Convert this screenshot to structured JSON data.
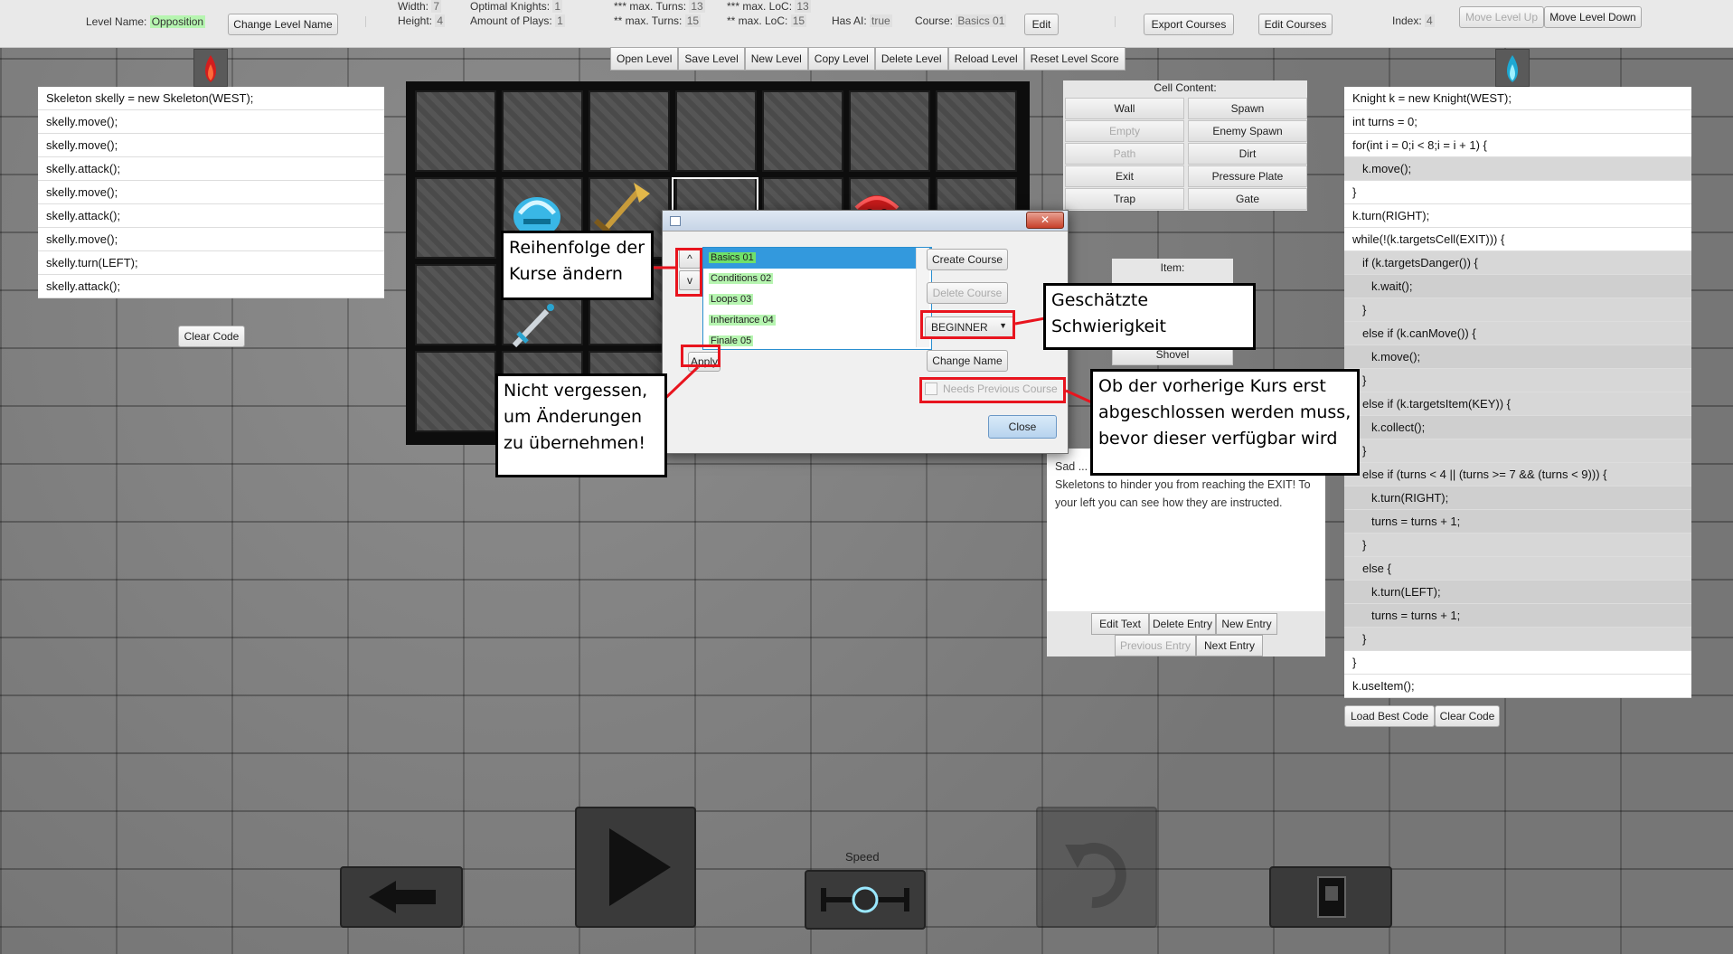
{
  "topbar": {
    "level_name_label": "Level Name:",
    "level_name_value": "Opposition",
    "change_level_name": "Change Level Name",
    "width_label": "Width:",
    "width_value": "7",
    "height_label": "Height:",
    "height_value": "4",
    "optimal_knights_label": "Optimal Knights:",
    "optimal_knights_value": "1",
    "plays_label": "Amount of Plays:",
    "plays_value": "1",
    "max_turns_3_label": "*** max. Turns:",
    "max_turns_3_value": "13",
    "max_turns_2_label": "** max. Turns:",
    "max_turns_2_value": "15",
    "max_loc_3_label": "*** max. LoC:",
    "max_loc_3_value": "13",
    "max_loc_2_label": "** max. LoC:",
    "max_loc_2_value": "15",
    "has_ai_label": "Has AI:",
    "has_ai_value": "true",
    "course_label": "Course:",
    "course_value": "Basics 01",
    "edit": "Edit",
    "export_courses": "Export Courses",
    "edit_courses": "Edit Courses",
    "index_label": "Index:",
    "index_value": "4",
    "move_level_up": "Move Level Up",
    "move_level_down": "Move Level Down"
  },
  "toolbar": [
    "Open Level",
    "Save Level",
    "New Level",
    "Copy Level",
    "Delete Level",
    "Reload Level",
    "Reset Level Score"
  ],
  "left_code": [
    "Skeleton skelly = new Skeleton(WEST);",
    "skelly.move();",
    "skelly.move();",
    "skelly.attack();",
    "skelly.move();",
    "skelly.attack();",
    "skelly.move();",
    "skelly.turn(LEFT);",
    "skelly.attack();"
  ],
  "left_clear_code": "Clear Code",
  "right_code": [
    {
      "text": "Knight k = new Knight(WEST);",
      "indent": 0
    },
    {
      "text": "int turns = 0;",
      "indent": 0
    },
    {
      "text": "for(int i = 0;i < 8;i = i + 1) {",
      "indent": 0
    },
    {
      "text": "k.move();",
      "indent": 1
    },
    {
      "text": "}",
      "indent": 0
    },
    {
      "text": "k.turn(RIGHT);",
      "indent": 0
    },
    {
      "text": "while(!(k.targetsCell(EXIT))) {",
      "indent": 0
    },
    {
      "text": "if (k.targetsDanger()) {",
      "indent": 1
    },
    {
      "text": "k.wait();",
      "indent": 2
    },
    {
      "text": "}",
      "indent": 1
    },
    {
      "text": "else if (k.canMove()) {",
      "indent": 1
    },
    {
      "text": "k.move();",
      "indent": 2
    },
    {
      "text": "}",
      "indent": 1
    },
    {
      "text": "else if (k.targetsItem(KEY)) {",
      "indent": 1
    },
    {
      "text": "k.collect();",
      "indent": 2
    },
    {
      "text": "}",
      "indent": 1
    },
    {
      "text": "else if (turns < 4 || (turns >= 7 && (turns < 9))) {",
      "indent": 1
    },
    {
      "text": "k.turn(RIGHT);",
      "indent": 2
    },
    {
      "text": "turns = turns + 1;",
      "indent": 2
    },
    {
      "text": "}",
      "indent": 1
    },
    {
      "text": "else {",
      "indent": 1
    },
    {
      "text": "k.turn(LEFT);",
      "indent": 2
    },
    {
      "text": "turns = turns + 1;",
      "indent": 2
    },
    {
      "text": "}",
      "indent": 1
    },
    {
      "text": "}",
      "indent": 0
    },
    {
      "text": "k.useItem();",
      "indent": 0
    }
  ],
  "right_buttons": {
    "load_best_code": "Load Best Code",
    "clear_code": "Clear Code"
  },
  "cell_content": {
    "title": "Cell Content:",
    "buttons": [
      {
        "label": "Wall",
        "enabled": true
      },
      {
        "label": "Spawn",
        "enabled": true
      },
      {
        "label": "Empty",
        "enabled": false
      },
      {
        "label": "Enemy Spawn",
        "enabled": true
      },
      {
        "label": "Path",
        "enabled": false
      },
      {
        "label": "Dirt",
        "enabled": true
      },
      {
        "label": "Exit",
        "enabled": true
      },
      {
        "label": "Pressure Plate",
        "enabled": true
      },
      {
        "label": "Trap",
        "enabled": true
      },
      {
        "label": "Gate",
        "enabled": true
      }
    ]
  },
  "item_panel": {
    "title": "Item:",
    "shovel": "Shovel"
  },
  "info_panel": {
    "text": "Sad ... using Java! An evil force is controlling Skeletons to hinder you from reaching the EXIT! To your left you can see how they are instructed.",
    "edit_text": "Edit Text",
    "delete_entry": "Delete Entry",
    "new_entry": "New Entry",
    "previous_entry": "Previous Entry",
    "next_entry": "Next Entry"
  },
  "dialog": {
    "up": "^",
    "down": "v",
    "courses": [
      "Basics 01",
      "Conditions 02",
      "Loops 03",
      "Inheritance 04",
      "Finale 05"
    ],
    "create_course": "Create Course",
    "delete_course": "Delete Course",
    "difficulty": "BEGINNER",
    "change_name": "Change Name",
    "apply": "Apply",
    "needs_previous_course": "Needs Previous Course",
    "close": "Close"
  },
  "callouts": {
    "reorder": "Reihenfolge der Kurse ändern",
    "difficulty": "Geschätzte Schwierigkeit",
    "apply": "Nicht vergessen, um Änderungen zu übernehmen!",
    "previous": "Ob der vorherige Kurs erst abgeschlossen werden muss, bevor dieser verfügbar wird"
  },
  "speed_label": "Speed"
}
